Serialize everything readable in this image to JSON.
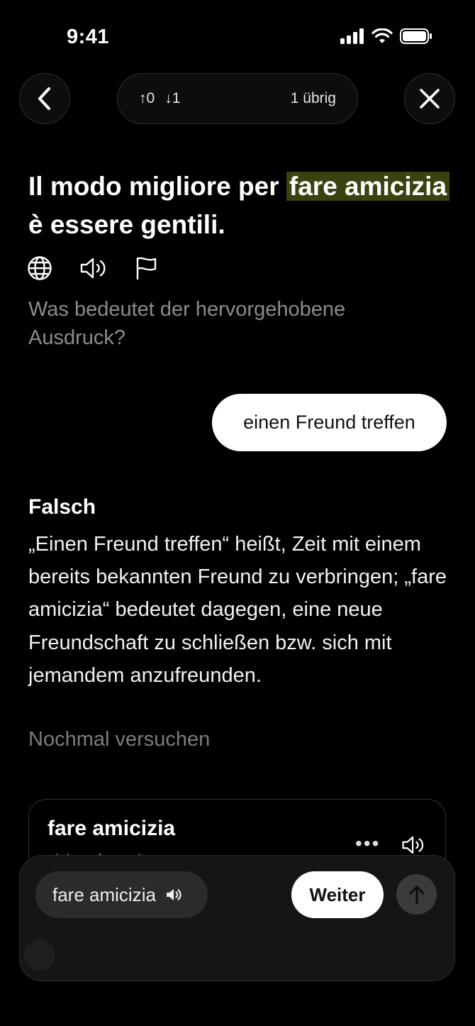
{
  "status_bar": {
    "time": "9:41"
  },
  "header": {
    "up_count": "↑0",
    "down_count": "↓1",
    "remaining": "1 übrig"
  },
  "exercise": {
    "sentence_before": "Il modo migliore per ",
    "highlight": "fare amicizia",
    "sentence_after": " è essere gentili.",
    "highlight_color": "#3b4210",
    "question": "Was bedeutet der hervorgehobene Ausdruck?",
    "selected_answer": "einen Freund treffen"
  },
  "feedback": {
    "verdict": "Falsch",
    "explanation": "„Einen Freund treffen“ heißt, Zeit mit einem bereits bekannten Freund zu verbringen; „fare amicizia“ bedeutet dagegen, eine neue Freundschaft zu schließen bzw. sich mit jemandem anzufreunden.",
    "retry": "Nochmal versuchen"
  },
  "vocab_card": {
    "title": "fare amicizia",
    "subtitle": "sich anfreunden",
    "more": "•••"
  },
  "bottom_bar": {
    "chip_label": "fare amicizia",
    "next_label": "Weiter"
  },
  "icons": [
    "back-arrow-icon",
    "close-icon",
    "globe-icon",
    "speaker-icon",
    "flag-icon",
    "more-icon",
    "send-arrow-icon"
  ]
}
